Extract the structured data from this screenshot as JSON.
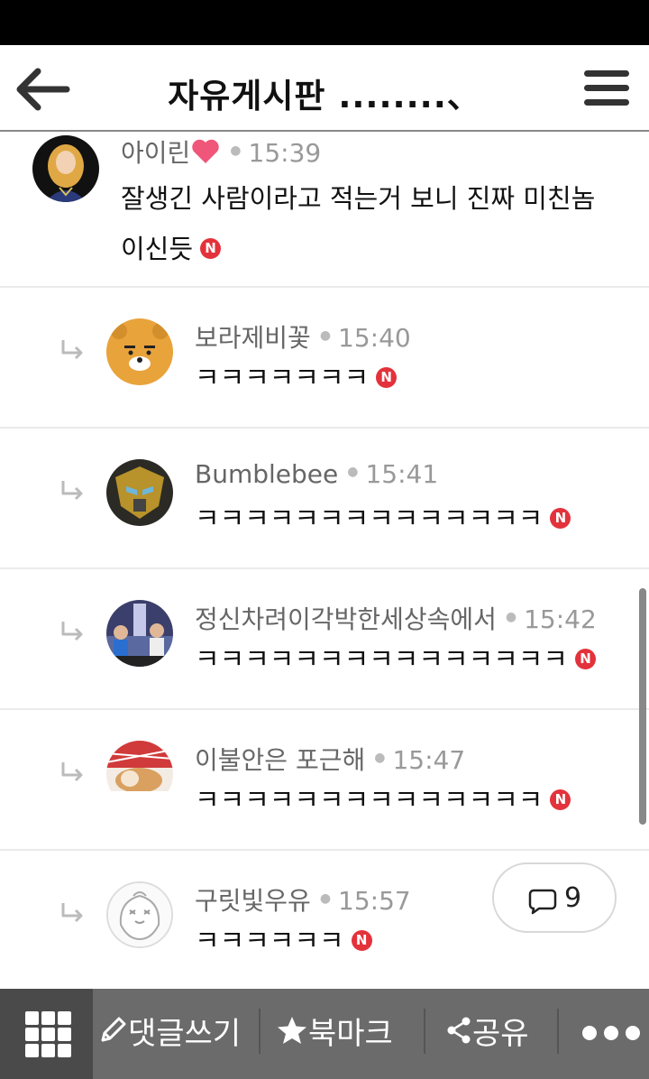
{
  "header": {
    "title": "자유게시판 ........、"
  },
  "comments": [
    {
      "author": "아이린",
      "time": "15:39",
      "text": "잘생긴 사람이라고 적는거 보니 진짜 미친놈 이신듯",
      "is_new": true,
      "avatar": "irene-avatar"
    },
    {
      "author": "보라제비꽃",
      "time": "15:40",
      "text": "ㅋㅋㅋㅋㅋㅋㅋ",
      "is_new": true,
      "avatar": "ryan-avatar"
    },
    {
      "author": "Bumblebee",
      "time": "15:41",
      "text": "ㅋㅋㅋㅋㅋㅋㅋㅋㅋㅋㅋㅋㅋㅋ",
      "is_new": true,
      "avatar": "bumblebee-avatar"
    },
    {
      "author": "정신차려이각박한세상속에서",
      "time": "15:42",
      "text": "ㅋㅋㅋㅋㅋㅋㅋㅋㅋㅋㅋㅋㅋㅋㅋ",
      "is_new": true,
      "avatar": "tv-show-avatar"
    },
    {
      "author": "이불안은 포근해",
      "time": "15:47",
      "text": "ㅋㅋㅋㅋㅋㅋㅋㅋㅋㅋㅋㅋㅋㅋ",
      "is_new": true,
      "avatar": "dog-avatar"
    },
    {
      "author": "구릿빛우유",
      "time": "15:57",
      "text": "ㅋㅋㅋㅋㅋㅋ",
      "is_new": true,
      "avatar": "apeach-avatar"
    }
  ],
  "new_badge": "N",
  "comment_count": "9",
  "toolbar": {
    "write_comment": "댓글쓰기",
    "bookmark": "북마크",
    "share": "공유"
  },
  "colors": {
    "new_badge": "#e3323b",
    "toolbar_bg": "#6b6b6b",
    "toolbar_grid_bg": "#4a4a4a",
    "heart": "#f0567a"
  }
}
